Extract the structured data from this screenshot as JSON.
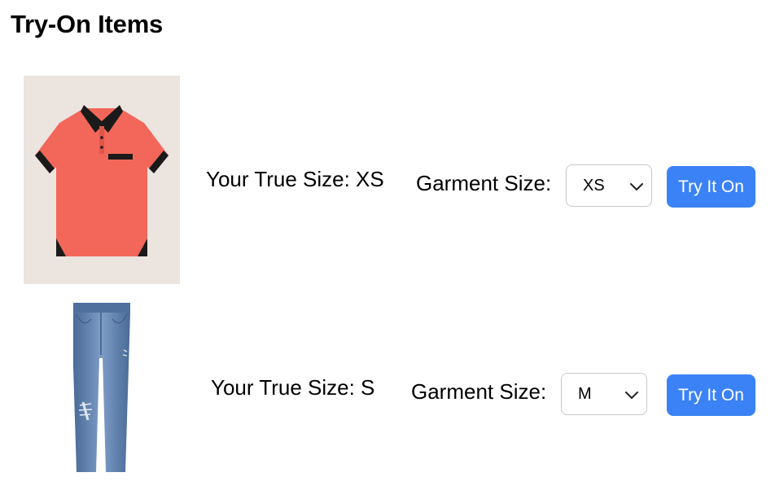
{
  "page": {
    "title": "Try-On Items"
  },
  "items": [
    {
      "image_alt": "Coral polo shirt",
      "true_size_label": "Your True Size: XS",
      "garment_size_label": "Garment Size:",
      "garment_size_value": "XS",
      "button_label": "Try It On"
    },
    {
      "image_alt": "Distressed blue jeans",
      "true_size_label": "Your True Size: S",
      "garment_size_label": "Garment Size:",
      "garment_size_value": "M",
      "button_label": "Try It On"
    }
  ],
  "colors": {
    "button_background": "#3b82f6",
    "polo_background": "#ebe4df",
    "polo_body": "#f2675a",
    "polo_trim": "#1a1a1a",
    "jeans": "#5d7fae"
  }
}
